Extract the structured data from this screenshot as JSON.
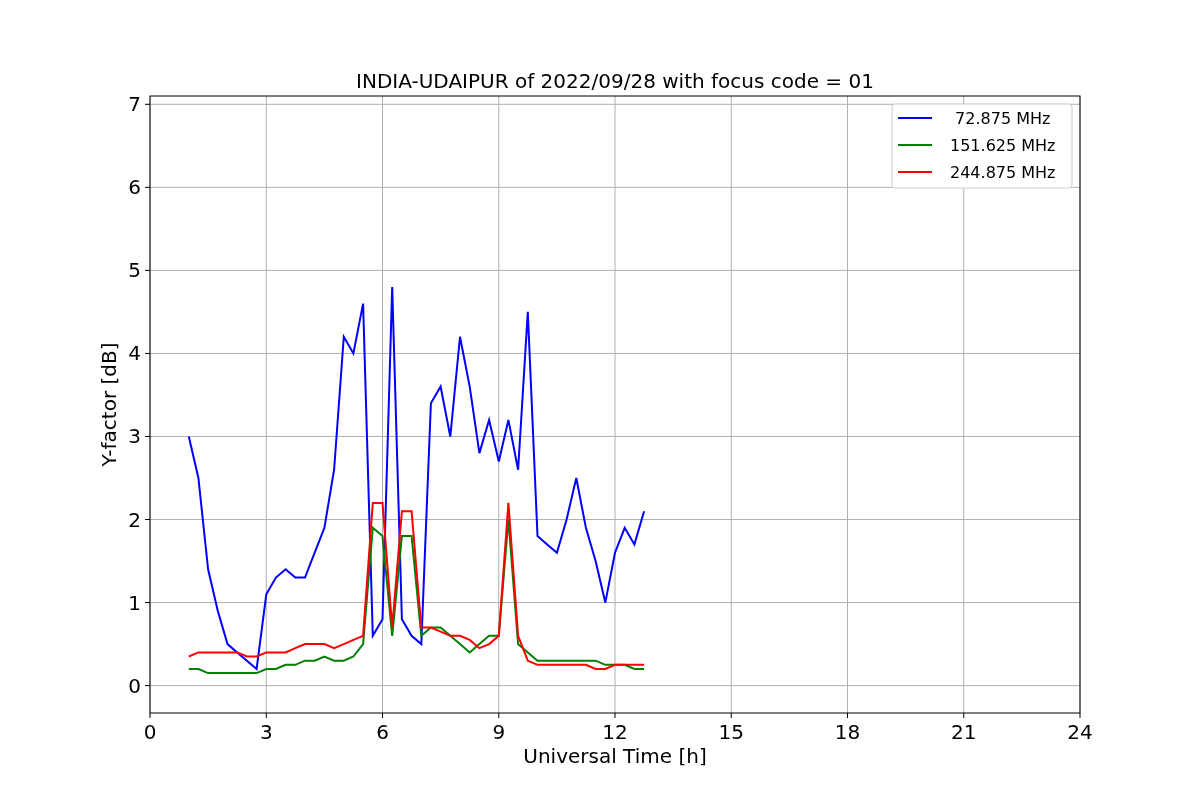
{
  "chart_data": {
    "type": "line",
    "title": "INDIA-UDAIPUR of 2022/09/28 with focus code = 01",
    "xlabel": "Universal Time [h]",
    "ylabel": "Y-factor [dB]",
    "x": [
      1.0,
      1.25,
      1.5,
      1.75,
      2.0,
      2.25,
      2.5,
      2.75,
      3.0,
      3.25,
      3.5,
      3.75,
      4.0,
      4.25,
      4.5,
      4.75,
      5.0,
      5.25,
      5.5,
      5.75,
      6.0,
      6.25,
      6.5,
      6.75,
      7.0,
      7.25,
      7.5,
      7.75,
      8.0,
      8.25,
      8.5,
      8.75,
      9.0,
      9.25,
      9.5,
      9.75,
      10.0,
      10.25,
      10.5,
      10.75,
      11.0,
      11.25,
      11.5,
      11.75,
      12.0,
      12.25,
      12.5,
      12.75
    ],
    "series": [
      {
        "name": " 72.875 MHz",
        "color": "#0000ff",
        "values": [
          3.0,
          2.5,
          1.4,
          0.9,
          0.5,
          0.4,
          0.3,
          0.2,
          1.1,
          1.3,
          1.4,
          1.3,
          1.3,
          1.6,
          1.9,
          2.6,
          4.2,
          4.0,
          4.6,
          0.6,
          0.8,
          4.8,
          0.8,
          0.6,
          0.5,
          3.4,
          3.6,
          3.0,
          4.2,
          3.6,
          2.8,
          3.2,
          2.7,
          3.2,
          2.6,
          4.5,
          1.8,
          1.7,
          1.6,
          2.0,
          2.5,
          1.9,
          1.5,
          1.0,
          1.6,
          1.9,
          1.7,
          2.1
        ]
      },
      {
        "name": "151.625 MHz",
        "color": "#008000",
        "values": [
          0.2,
          0.2,
          0.15,
          0.15,
          0.15,
          0.15,
          0.15,
          0.15,
          0.2,
          0.2,
          0.25,
          0.25,
          0.3,
          0.3,
          0.35,
          0.3,
          0.3,
          0.35,
          0.5,
          1.9,
          1.8,
          0.6,
          1.8,
          1.8,
          0.6,
          0.7,
          0.7,
          0.6,
          0.5,
          0.4,
          0.5,
          0.6,
          0.6,
          2.0,
          0.5,
          0.4,
          0.3,
          0.3,
          0.3,
          0.3,
          0.3,
          0.3,
          0.3,
          0.25,
          0.25,
          0.25,
          0.2,
          0.2
        ]
      },
      {
        "name": "244.875 MHz",
        "color": "#ff0000",
        "values": [
          0.35,
          0.4,
          0.4,
          0.4,
          0.4,
          0.4,
          0.35,
          0.35,
          0.4,
          0.4,
          0.4,
          0.45,
          0.5,
          0.5,
          0.5,
          0.45,
          0.5,
          0.55,
          0.6,
          2.2,
          2.2,
          0.7,
          2.1,
          2.1,
          0.7,
          0.7,
          0.65,
          0.6,
          0.6,
          0.55,
          0.45,
          0.5,
          0.6,
          2.2,
          0.6,
          0.3,
          0.25,
          0.25,
          0.25,
          0.25,
          0.25,
          0.25,
          0.2,
          0.2,
          0.25,
          0.25,
          0.25,
          0.25
        ]
      }
    ],
    "xlim": [
      0,
      24
    ],
    "ylim": [
      -0.33,
      7.1
    ],
    "xticks": [
      0,
      3,
      6,
      9,
      12,
      15,
      18,
      21,
      24
    ],
    "yticks": [
      0,
      1,
      2,
      3,
      4,
      5,
      6,
      7
    ],
    "grid": true,
    "legend": true
  }
}
